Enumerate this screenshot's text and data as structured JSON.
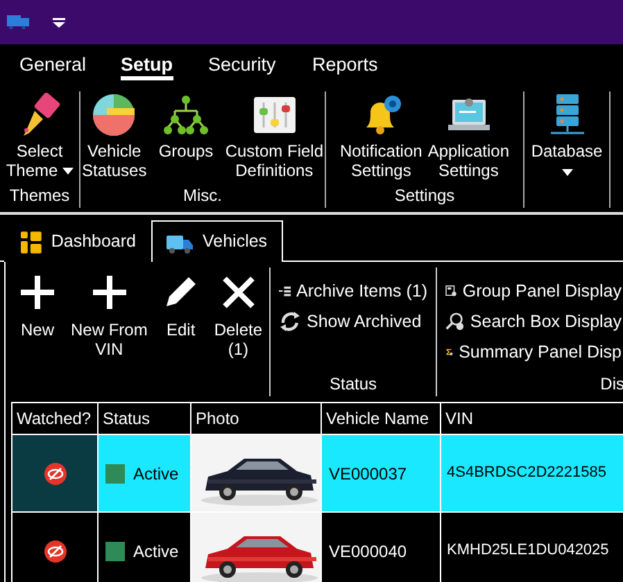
{
  "ribbon_tabs": [
    {
      "label": "General",
      "selected": false
    },
    {
      "label": "Setup",
      "selected": true
    },
    {
      "label": "Security",
      "selected": false
    },
    {
      "label": "Reports",
      "selected": false
    }
  ],
  "ribbon_groups": [
    {
      "label": "Themes",
      "buttons": [
        {
          "lines": [
            "Select",
            "Theme"
          ],
          "dropdown": true
        }
      ]
    },
    {
      "label": "Misc.",
      "buttons": [
        {
          "lines": [
            "Vehicle",
            "Statuses"
          ],
          "dropdown": false
        },
        {
          "lines": [
            "Groups"
          ],
          "dropdown": false
        },
        {
          "lines": [
            "Custom Field",
            "Definitions"
          ],
          "dropdown": false
        }
      ]
    },
    {
      "label": "Settings",
      "buttons": [
        {
          "lines": [
            "Notification",
            "Settings"
          ],
          "dropdown": false
        },
        {
          "lines": [
            "Application",
            "Settings"
          ],
          "dropdown": false
        }
      ]
    },
    {
      "buttons": [
        {
          "lines": [
            "Database"
          ],
          "dropdown": true
        }
      ]
    }
  ],
  "document_tabs": [
    {
      "label": "Dashboard",
      "selected": false
    },
    {
      "label": "Vehicles",
      "selected": true
    }
  ],
  "toolbar": {
    "large_buttons": [
      {
        "lines": [
          "New"
        ]
      },
      {
        "lines": [
          "New From",
          "VIN"
        ]
      },
      {
        "lines": [
          "Edit"
        ]
      },
      {
        "lines": [
          "Delete",
          "(1)"
        ]
      }
    ],
    "groups": [
      {
        "label": "Status",
        "items": [
          "Archive Items (1)",
          "Show Archived"
        ]
      },
      {
        "label": "Dis",
        "items": [
          "Group Panel Display",
          "Search Box Display",
          "Summary Panel Disp"
        ]
      }
    ]
  },
  "table": {
    "columns": [
      "Watched?",
      "Status",
      "Photo",
      "Vehicle Name",
      "VIN"
    ],
    "rows": [
      {
        "selected": true,
        "watched": false,
        "status": "Active",
        "color": "#2e8b57",
        "vehicle_name": "VE000037",
        "vin": "4S4BRDSC2D2221585"
      },
      {
        "selected": false,
        "watched": false,
        "status": "Active",
        "color": "#2e8b57",
        "vehicle_name": "VE000040",
        "vin": "KMHD25LE1DU042025"
      }
    ]
  }
}
